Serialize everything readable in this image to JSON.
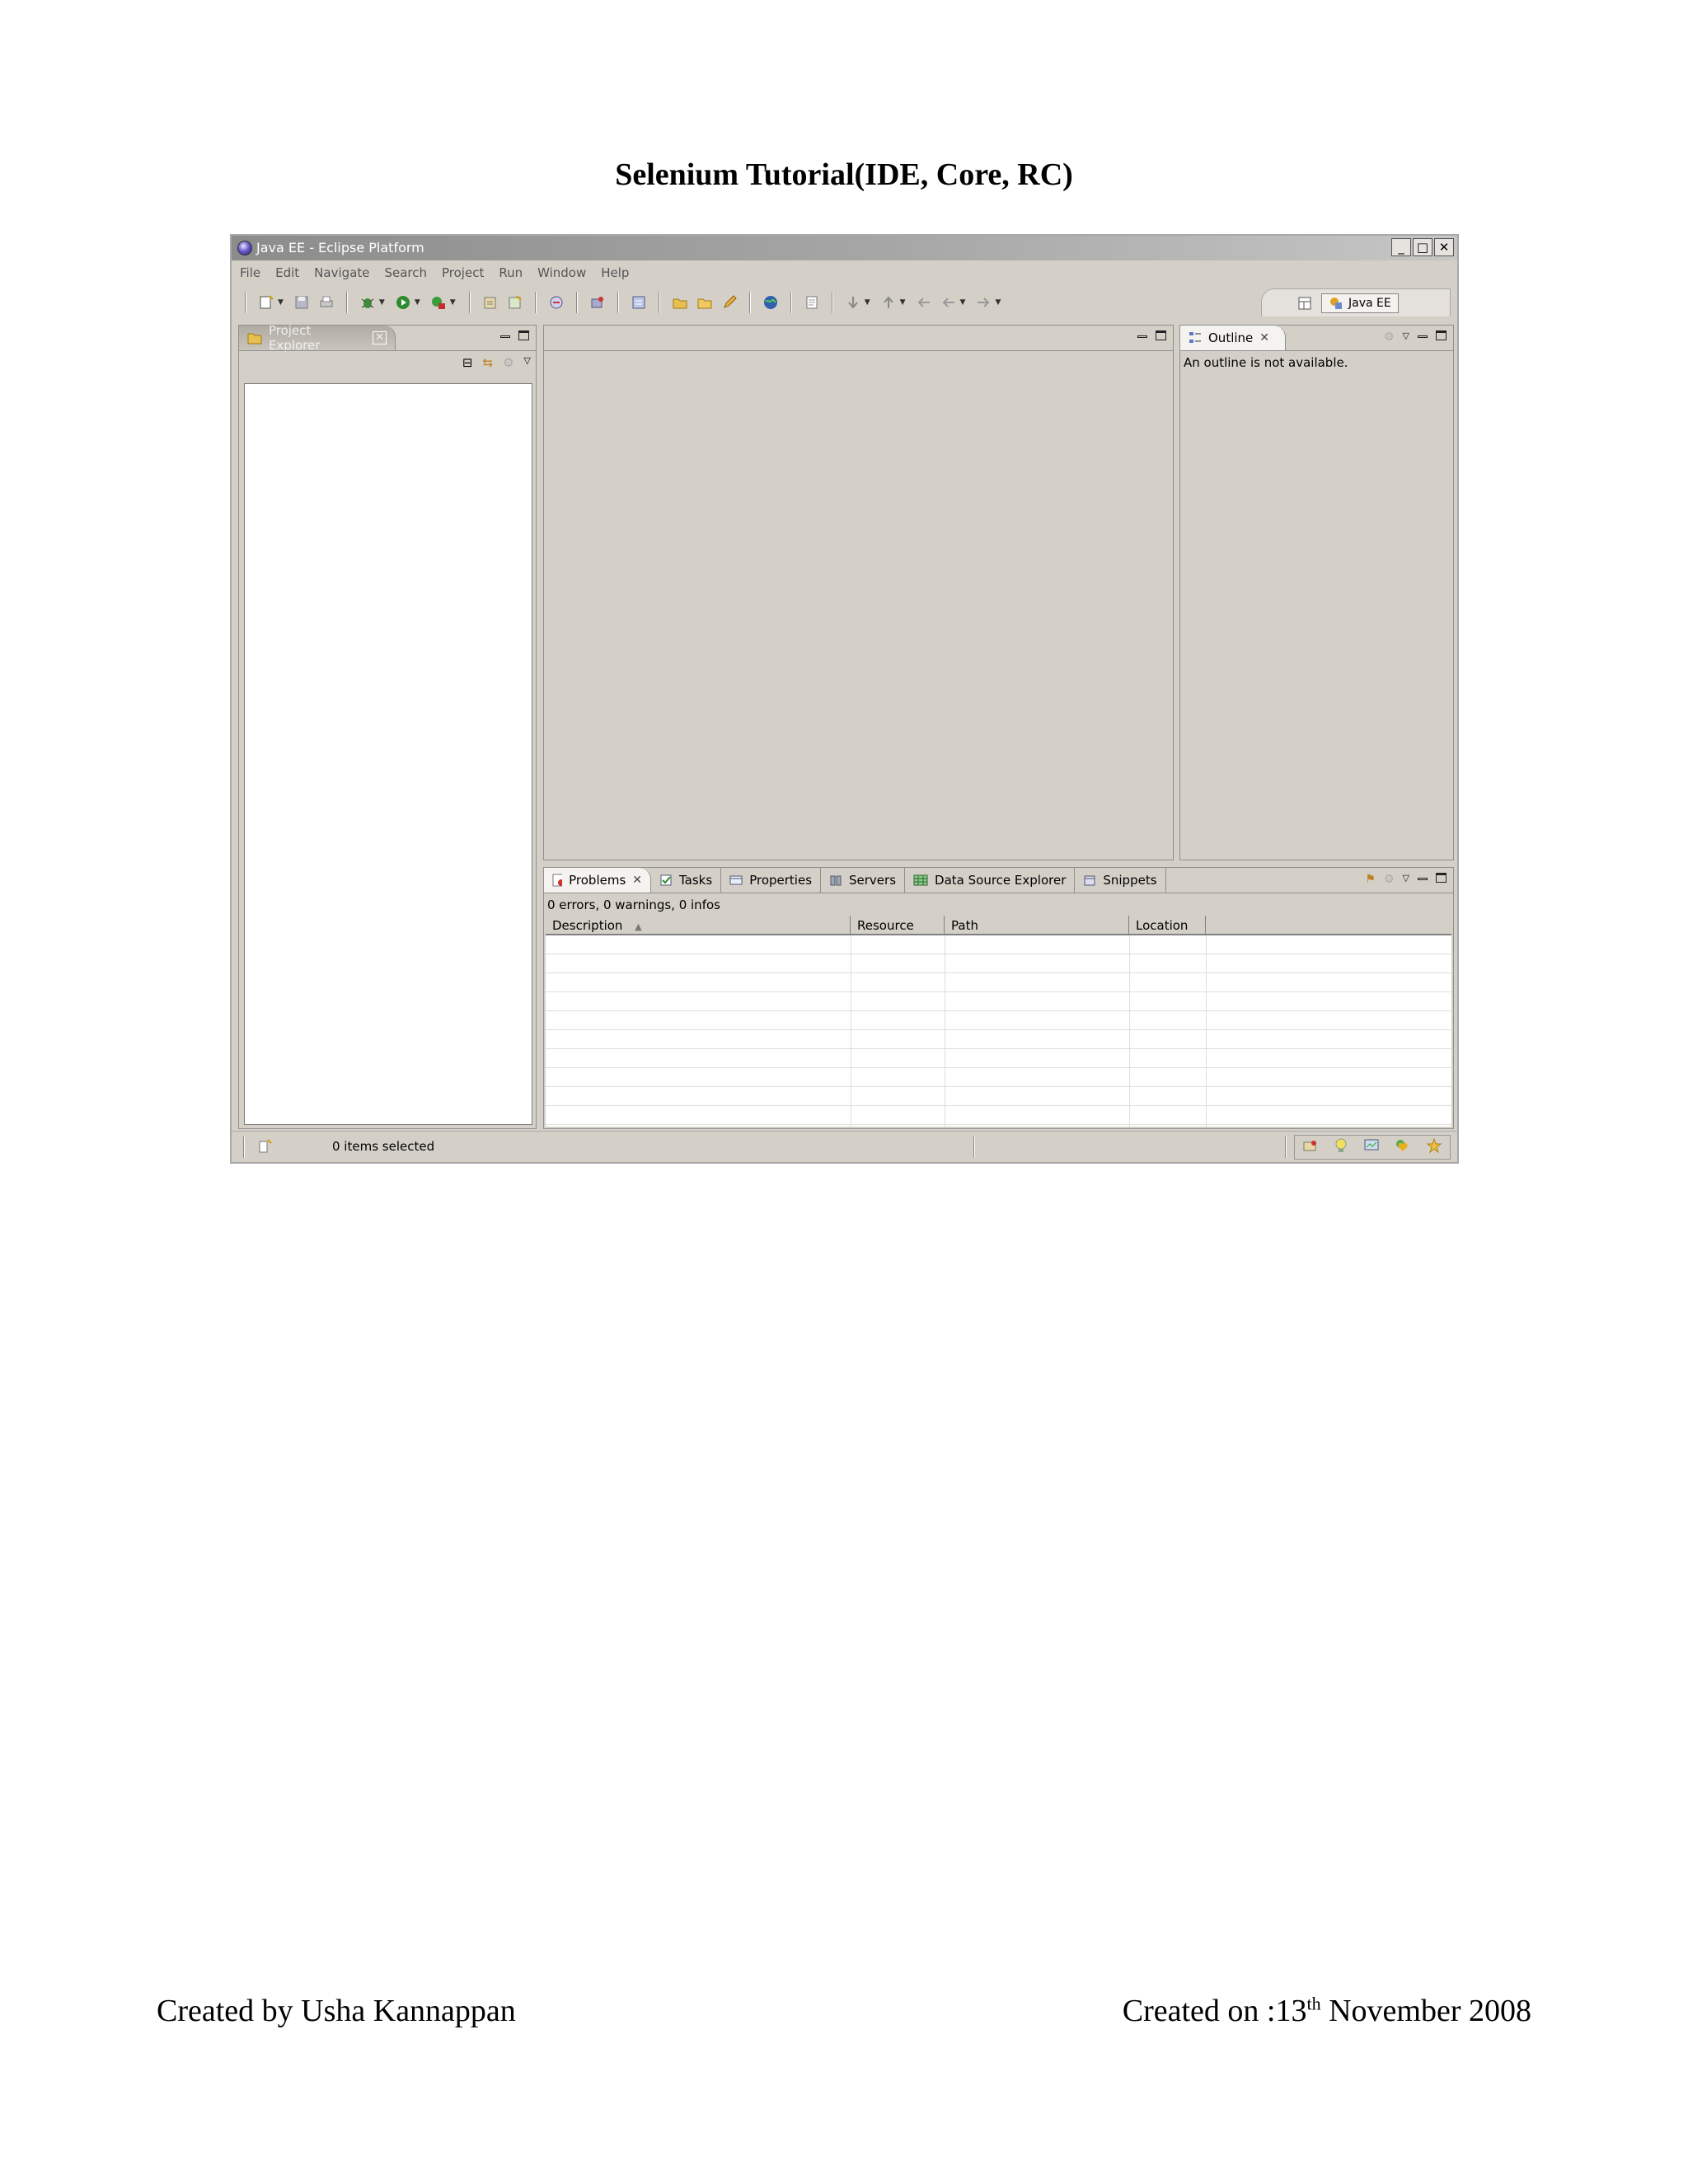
{
  "document": {
    "title": "Selenium Tutorial(IDE, Core, RC)",
    "footer": {
      "author": "Created by Usha Kannappan",
      "date_prefix": "Created on :13",
      "date_suffix": "th",
      "date_rest": " November 2008"
    }
  },
  "window": {
    "title": "Java EE - Eclipse Platform",
    "controls": {
      "minimize": "_",
      "maximize": "□",
      "close": "✕"
    }
  },
  "menubar": [
    "File",
    "Edit",
    "Navigate",
    "Search",
    "Project",
    "Run",
    "Window",
    "Help"
  ],
  "perspective": {
    "label": "Java EE"
  },
  "project_explorer": {
    "tab_label": "Project Explorer"
  },
  "outline": {
    "tab_label": "Outline",
    "message": "An outline is not available."
  },
  "bottom_tabs": [
    {
      "label": "Problems",
      "active": true
    },
    {
      "label": "Tasks"
    },
    {
      "label": "Properties"
    },
    {
      "label": "Servers"
    },
    {
      "label": "Data Source Explorer"
    },
    {
      "label": "Snippets"
    }
  ],
  "problems": {
    "summary": "0 errors, 0 warnings, 0 infos",
    "columns": [
      "Description",
      "Resource",
      "Path",
      "Location"
    ]
  },
  "statusbar": {
    "text": "0 items selected"
  }
}
